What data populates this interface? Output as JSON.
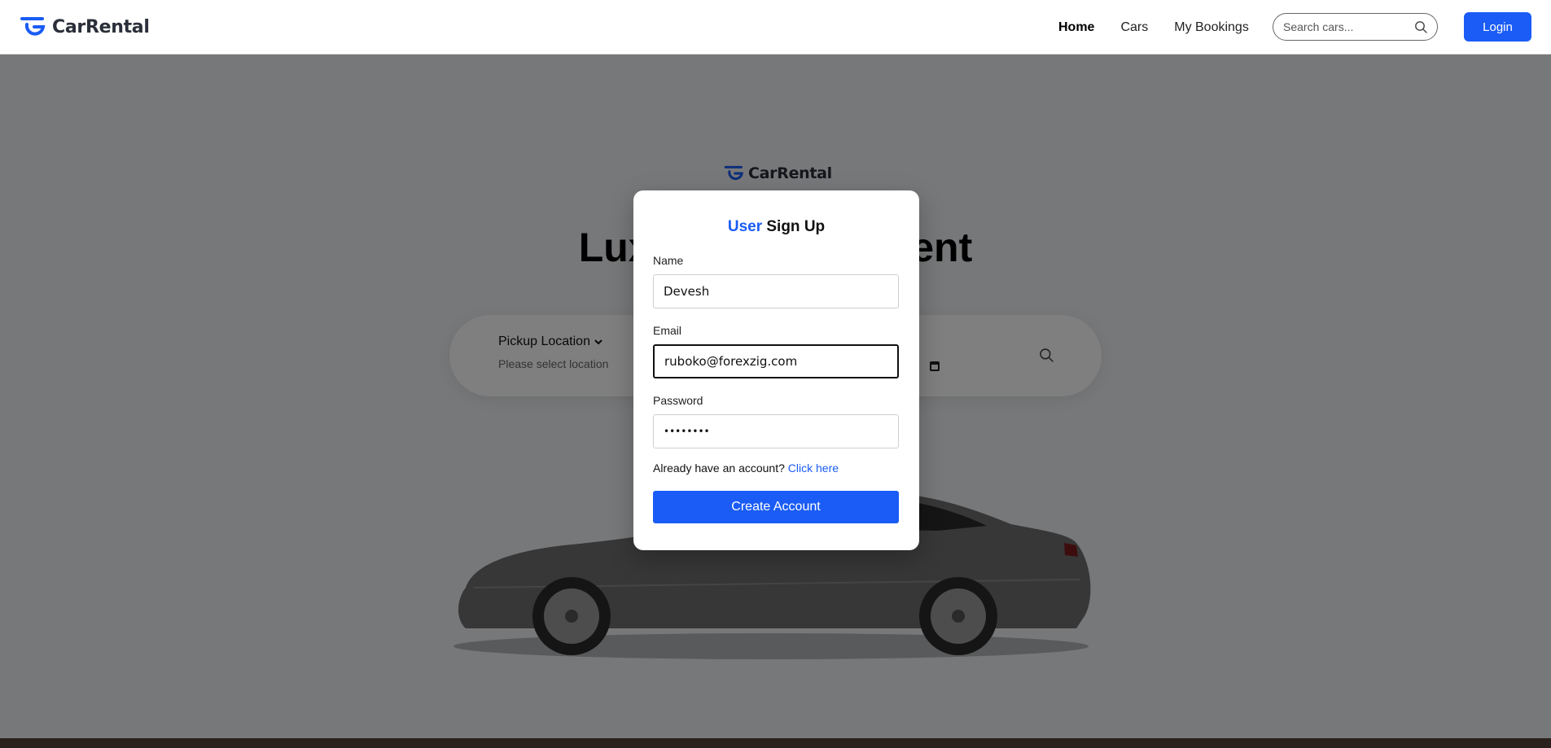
{
  "brand": {
    "name": "CarRental",
    "accent": "#1a5cf5"
  },
  "nav": {
    "links": [
      {
        "label": "Home",
        "active": true
      },
      {
        "label": "Cars",
        "active": false
      },
      {
        "label": "My Bookings",
        "active": false
      }
    ],
    "search_placeholder": "Search cars...",
    "login_label": "Login"
  },
  "hero": {
    "title": "Luxury cars on Rent",
    "pickup_label": "Pickup Location",
    "pickup_sub": "Please select location"
  },
  "modal": {
    "title_accent": "User",
    "title_rest": "Sign Up",
    "name_label": "Name",
    "name_value": "Devesh",
    "email_label": "Email",
    "email_value": "ruboko@forexzig.com",
    "password_label": "Password",
    "password_value": "••••••••",
    "have_account_text": "Already have an account?",
    "click_here": "Click here",
    "create_label": "Create Account"
  }
}
